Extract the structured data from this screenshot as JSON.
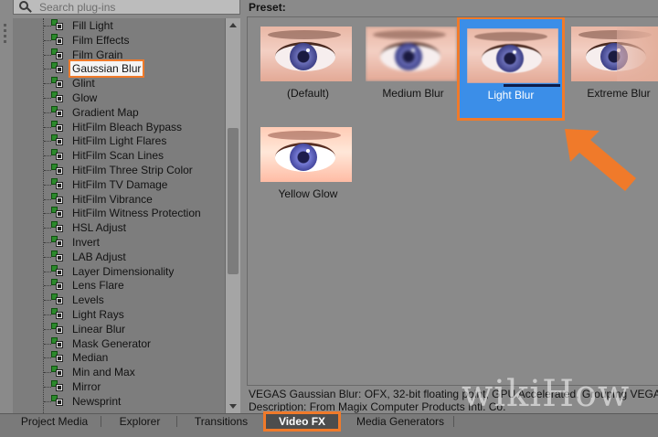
{
  "search": {
    "placeholder": "Search plug-ins"
  },
  "tree": {
    "items": [
      {
        "label": "Fill Light"
      },
      {
        "label": "Film Effects"
      },
      {
        "label": "Film Grain"
      },
      {
        "label": "Gaussian Blur",
        "selected": true
      },
      {
        "label": "Glint"
      },
      {
        "label": "Glow"
      },
      {
        "label": "Gradient Map"
      },
      {
        "label": "HitFilm Bleach Bypass"
      },
      {
        "label": "HitFilm Light Flares"
      },
      {
        "label": "HitFilm Scan Lines"
      },
      {
        "label": "HitFilm Three Strip Color"
      },
      {
        "label": "HitFilm TV Damage"
      },
      {
        "label": "HitFilm Vibrance"
      },
      {
        "label": "HitFilm Witness Protection"
      },
      {
        "label": "HSL Adjust"
      },
      {
        "label": "Invert"
      },
      {
        "label": "LAB Adjust"
      },
      {
        "label": "Layer Dimensionality"
      },
      {
        "label": "Lens Flare"
      },
      {
        "label": "Levels"
      },
      {
        "label": "Light Rays"
      },
      {
        "label": "Linear Blur"
      },
      {
        "label": "Mask Generator"
      },
      {
        "label": "Median"
      },
      {
        "label": "Min and Max"
      },
      {
        "label": "Mirror"
      },
      {
        "label": "Newsprint"
      }
    ]
  },
  "preset": {
    "header": "Preset:",
    "items": [
      {
        "label": "(Default)"
      },
      {
        "label": "Medium Blur"
      },
      {
        "label": "Light Blur",
        "selected": true
      },
      {
        "label": "Extreme Blur"
      },
      {
        "label": "Yellow Glow"
      }
    ]
  },
  "description": {
    "line1": "VEGAS Gaussian Blur: OFX, 32-bit floating point, GPU Accelerated, Grouping VEGAS",
    "line2": "Description: From Magix Computer Products Intl. Co."
  },
  "watermark": "wikiHow",
  "tabs": [
    {
      "label": "Project Media"
    },
    {
      "label": "Explorer"
    },
    {
      "label": "Transitions"
    },
    {
      "label": "Video FX",
      "active": true
    },
    {
      "label": "Media Generators"
    }
  ],
  "colors": {
    "highlight_orange": "#f07a2a",
    "selection_blue": "#3b8ee8"
  }
}
